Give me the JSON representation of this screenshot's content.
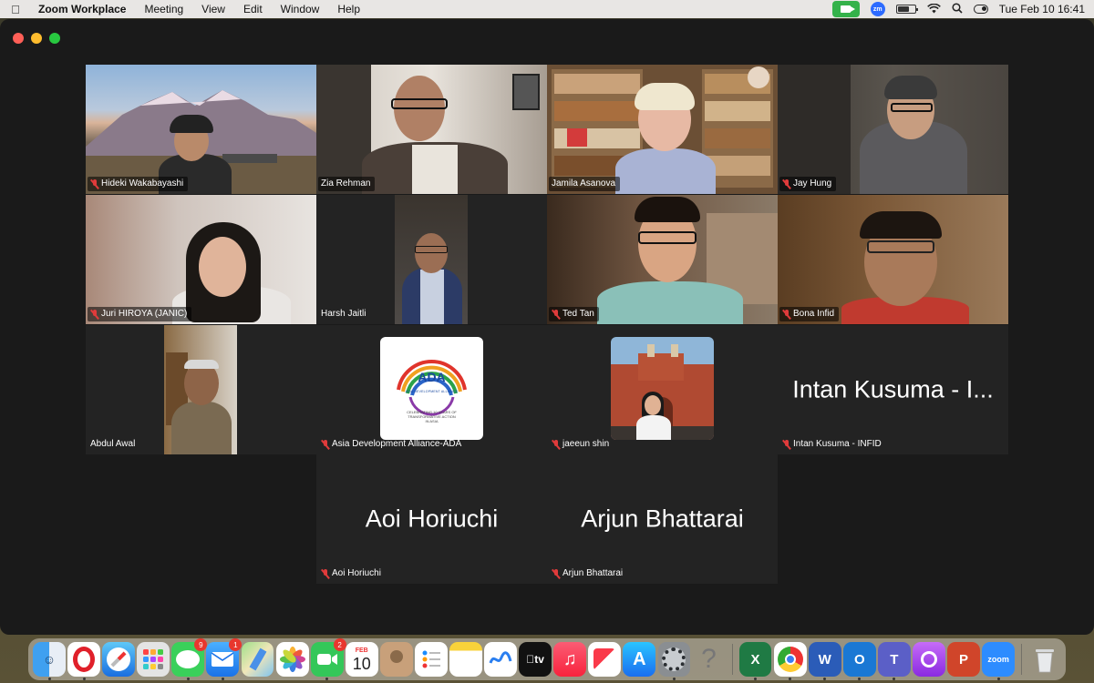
{
  "menubar": {
    "app_name": "Zoom Workplace",
    "menus": [
      "Meeting",
      "View",
      "Edit",
      "Window",
      "Help"
    ],
    "zoom_badge": "zm",
    "clock": "Tue Feb 10  16:41"
  },
  "participants": [
    {
      "name": "Hideki Wakabayashi",
      "muted": true
    },
    {
      "name": "Zia Rehman",
      "muted": false
    },
    {
      "name": "Jamila Asanova",
      "muted": false,
      "active_speaker": true
    },
    {
      "name": "Jay Hung",
      "muted": true
    },
    {
      "name": "Juri HIROYA (JANIC)",
      "muted": true
    },
    {
      "name": "Harsh Jaitli",
      "muted": false
    },
    {
      "name": "Ted Tan",
      "muted": true
    },
    {
      "name": "Bona Infid",
      "muted": true
    },
    {
      "name": "Abdul Awal",
      "muted": false
    },
    {
      "name": "Asia Development Alliance-ADA",
      "muted": true,
      "logo_text": "ADA",
      "logo_caption": "ASIA DEVELOPMENT ALLIANCE",
      "logo_tagline": "CELEBRATING 10 YEARS OF TRANSFORMATIVE ACTION IN ASIA"
    },
    {
      "name": "jaeeun shin",
      "muted": true
    },
    {
      "name": "Intan Kusuma - INFID",
      "muted": true,
      "display_text": "Intan Kusuma - I..."
    },
    {
      "name": "Aoi Horiuchi",
      "muted": true,
      "display_text": "Aoi Horiuchi"
    },
    {
      "name": "Arjun Bhattarai",
      "muted": true,
      "display_text": "Arjun Bhattarai"
    }
  ],
  "dock": {
    "apps": [
      {
        "icon": "finder-icon"
      },
      {
        "icon": "opera-icon"
      },
      {
        "icon": "safari-icon"
      },
      {
        "icon": "launchpad-icon"
      },
      {
        "icon": "messages-icon",
        "badge": "9"
      },
      {
        "icon": "mail-icon",
        "badge": "1"
      },
      {
        "icon": "maps-icon"
      },
      {
        "icon": "photos-icon"
      },
      {
        "icon": "facetime-icon",
        "badge": "2"
      },
      {
        "icon": "calendar-icon",
        "month": "FEB",
        "day": "10"
      },
      {
        "icon": "contacts-icon"
      },
      {
        "icon": "reminders-icon"
      },
      {
        "icon": "notes-icon"
      },
      {
        "icon": "freeform-icon"
      },
      {
        "icon": "appletv-icon",
        "label": "tv"
      },
      {
        "icon": "music-icon"
      },
      {
        "icon": "news-icon"
      },
      {
        "icon": "appstore-icon"
      },
      {
        "icon": "system-settings-icon"
      },
      {
        "icon": "help-icon",
        "label": "?"
      },
      {
        "icon": "excel-icon",
        "label": "X"
      },
      {
        "icon": "chrome-icon"
      },
      {
        "icon": "word-icon",
        "label": "W"
      },
      {
        "icon": "outlook-icon",
        "label": "O"
      },
      {
        "icon": "teams-icon",
        "label": "T"
      },
      {
        "icon": "podcasts-icon"
      },
      {
        "icon": "powerpoint-icon",
        "label": "P"
      },
      {
        "icon": "zoom-icon",
        "label": "zoom"
      },
      {
        "icon": "trash-icon"
      }
    ]
  },
  "colors": {
    "active_speaker_border": "#2fd05a",
    "mute_icon": "#e03b3b",
    "tile_background": "#232323"
  }
}
